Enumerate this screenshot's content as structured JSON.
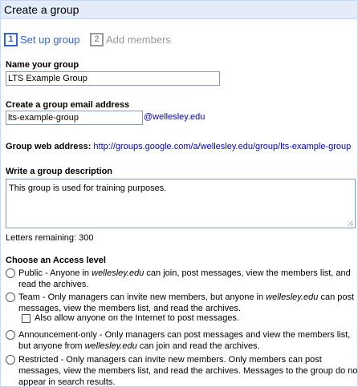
{
  "title": "Create a group",
  "steps": [
    {
      "num": "1",
      "label": "Set up group",
      "active": true
    },
    {
      "num": "2",
      "label": "Add members",
      "active": false
    }
  ],
  "form": {
    "name_label": "Name your group",
    "name_value": "LTS Example Group",
    "email_label": "Create a group email address",
    "email_value": "lts-example-group",
    "email_domain": "@wellesley.edu",
    "web_label": "Group web address:",
    "web_url": "http://groups.google.com/a/wellesley.edu/group/lts-example-group",
    "desc_label": "Write a group description",
    "desc_value": "This group is used for training purposes.",
    "letters_remaining": "Letters remaining: 300"
  },
  "access": {
    "heading": "Choose an Access level",
    "options": [
      {
        "name": "Public",
        "pre": "Public - Anyone in ",
        "em": "wellesley.edu",
        "post": " can join, post messages, view the members list, and read the archives."
      },
      {
        "name": "Team",
        "pre": "Team - Only managers can invite new members, but anyone in ",
        "em": "wellesley.edu",
        "post": " can post messages, view the members list, and read the archives."
      },
      {
        "name": "Announcement-only",
        "pre": "Announcement-only - Only managers can post messages and view the members list, but anyone from ",
        "em": "wellesley.edu",
        "post": " can join and read the archives."
      },
      {
        "name": "Restricted",
        "pre": "Restricted - Only managers can invite new members. Only members can post messages, view the members list, and read the archives. Messages to the group do not appear in search results.",
        "em": "",
        "post": ""
      }
    ],
    "team_checkbox_label": "Also allow anyone on the Internet to post messages."
  }
}
